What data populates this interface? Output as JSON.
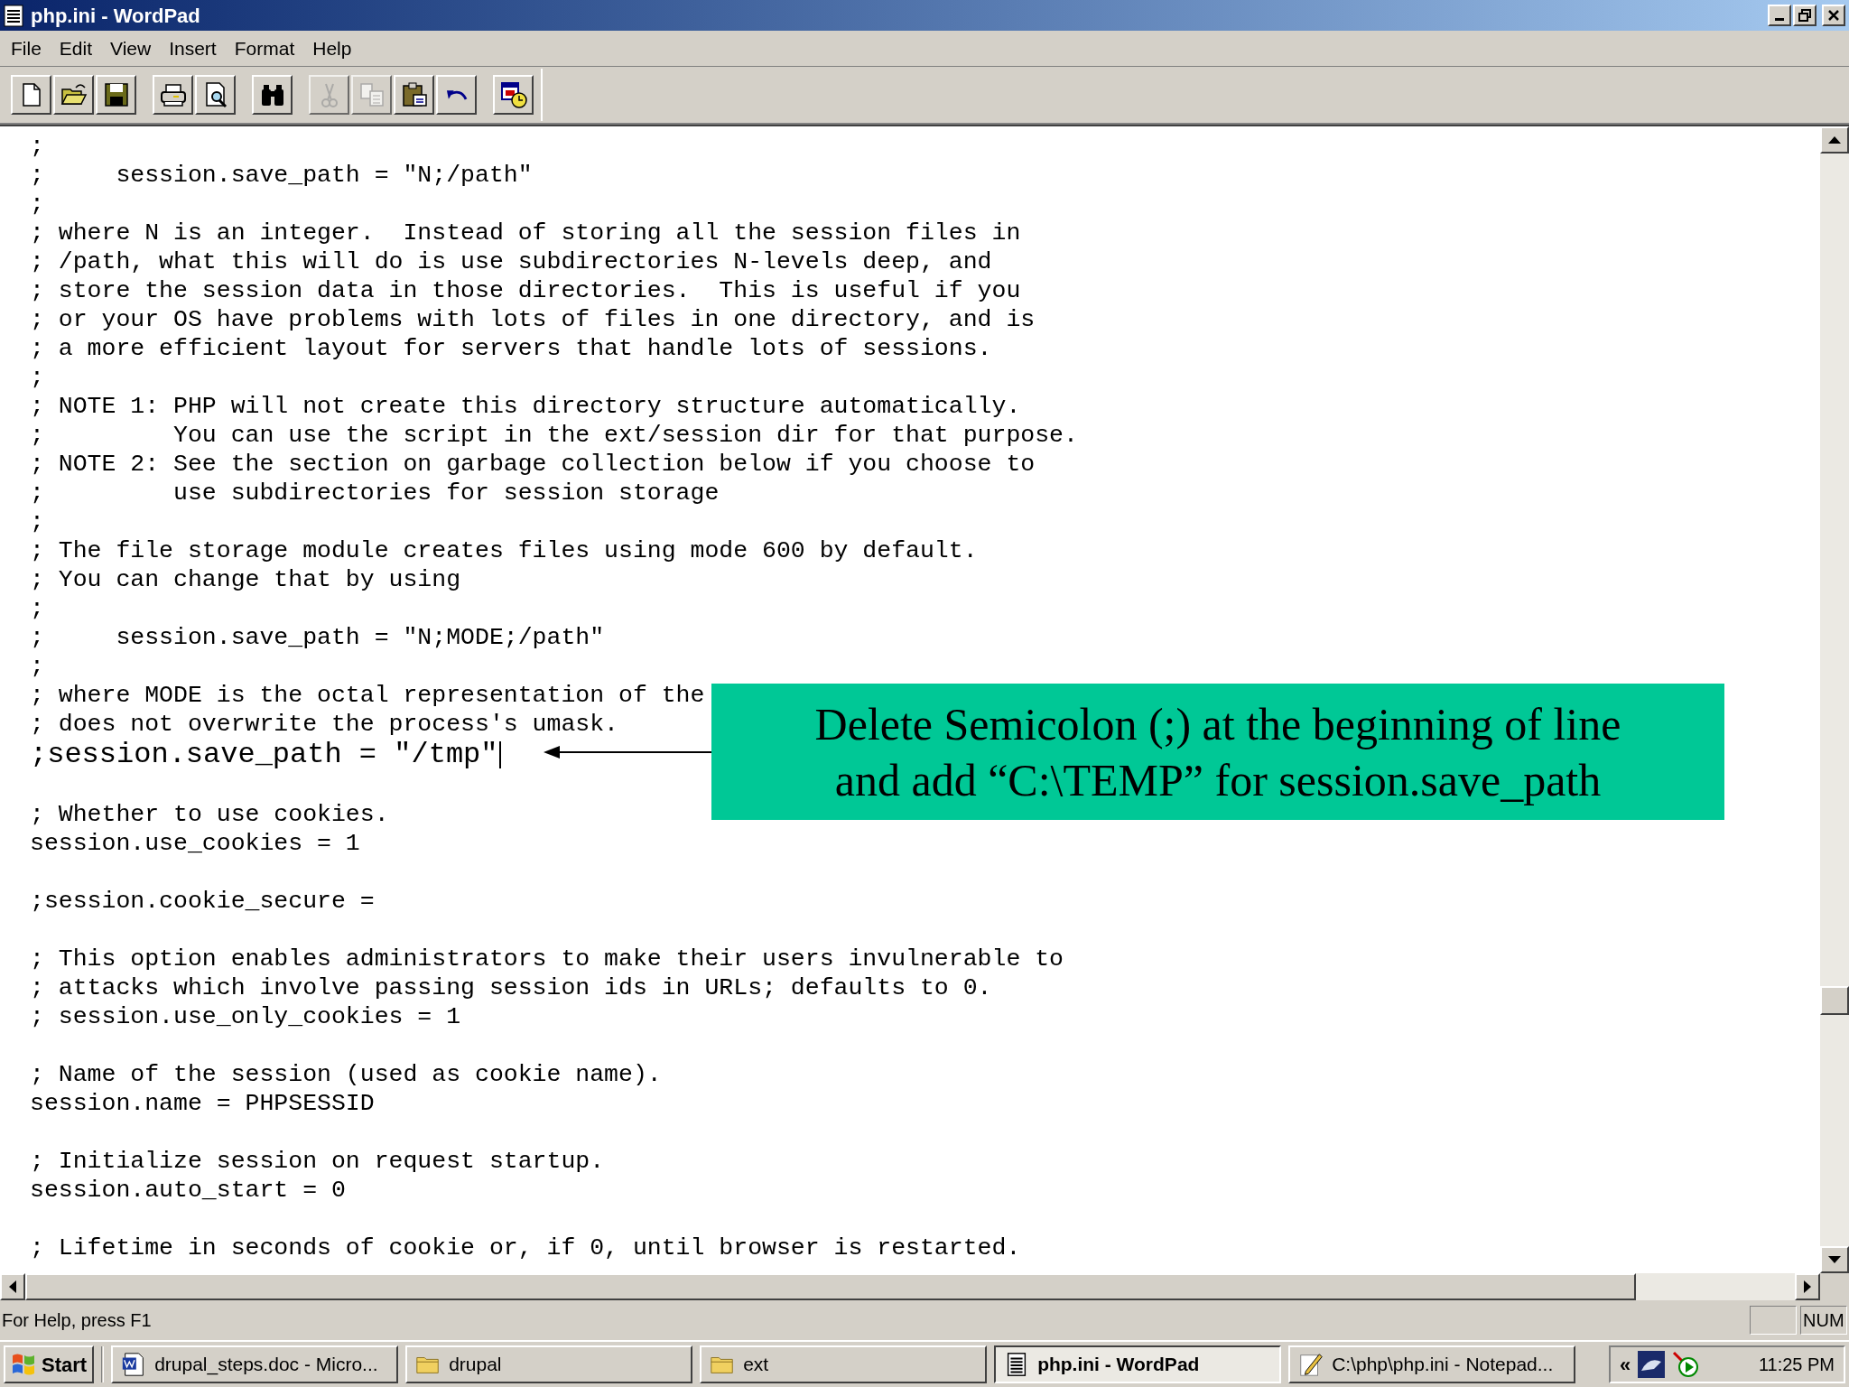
{
  "window": {
    "title": "php.ini - WordPad"
  },
  "menu": [
    "File",
    "Edit",
    "View",
    "Insert",
    "Format",
    "Help"
  ],
  "toolbar": [
    [
      {
        "kind": "new",
        "disabled": false
      },
      {
        "kind": "open",
        "disabled": false
      },
      {
        "kind": "save",
        "disabled": false
      }
    ],
    [
      {
        "kind": "print",
        "disabled": false
      },
      {
        "kind": "preview",
        "disabled": false
      }
    ],
    [
      {
        "kind": "find",
        "disabled": false
      }
    ],
    [
      {
        "kind": "cut",
        "disabled": true
      },
      {
        "kind": "copy",
        "disabled": true
      },
      {
        "kind": "paste",
        "disabled": false
      },
      {
        "kind": "undo",
        "disabled": false
      }
    ],
    [
      {
        "kind": "datetime",
        "disabled": false
      }
    ]
  ],
  "document": {
    "lines": [
      {
        "kind": "normal",
        "text": ";"
      },
      {
        "kind": "normal",
        "text": ";     session.save_path = \"N;/path\""
      },
      {
        "kind": "normal",
        "text": ";"
      },
      {
        "kind": "normal",
        "text": "; where N is an integer.  Instead of storing all the session files in"
      },
      {
        "kind": "normal",
        "text": "; /path, what this will do is use subdirectories N-levels deep, and"
      },
      {
        "kind": "normal",
        "text": "; store the session data in those directories.  This is useful if you"
      },
      {
        "kind": "normal",
        "text": "; or your OS have problems with lots of files in one directory, and is"
      },
      {
        "kind": "normal",
        "text": "; a more efficient layout for servers that handle lots of sessions."
      },
      {
        "kind": "normal",
        "text": ";"
      },
      {
        "kind": "normal",
        "text": "; NOTE 1: PHP will not create this directory structure automatically."
      },
      {
        "kind": "normal",
        "text": ";         You can use the script in the ext/session dir for that purpose."
      },
      {
        "kind": "normal",
        "text": "; NOTE 2: See the section on garbage collection below if you choose to"
      },
      {
        "kind": "normal",
        "text": ";         use subdirectories for session storage"
      },
      {
        "kind": "normal",
        "text": ";"
      },
      {
        "kind": "normal",
        "text": "; The file storage module creates files using mode 600 by default."
      },
      {
        "kind": "normal",
        "text": "; You can change that by using"
      },
      {
        "kind": "normal",
        "text": ";"
      },
      {
        "kind": "normal",
        "text": ";     session.save_path = \"N;MODE;/path\""
      },
      {
        "kind": "normal",
        "text": ";"
      },
      {
        "kind": "normal",
        "text": "; where MODE is the octal representation of the"
      },
      {
        "kind": "normal",
        "text": "; does not overwrite the process's umask."
      },
      {
        "kind": "large",
        "text": ";session.save_path = \"/tmp\""
      },
      {
        "kind": "blank"
      },
      {
        "kind": "normal",
        "text": "; Whether to use cookies."
      },
      {
        "kind": "normal",
        "text": "session.use_cookies = 1"
      },
      {
        "kind": "blank"
      },
      {
        "kind": "normal",
        "text": ";session.cookie_secure ="
      },
      {
        "kind": "blank"
      },
      {
        "kind": "normal",
        "text": "; This option enables administrators to make their users invulnerable to"
      },
      {
        "kind": "normal",
        "text": "; attacks which involve passing session ids in URLs; defaults to 0."
      },
      {
        "kind": "normal",
        "text": "; session.use_only_cookies = 1"
      },
      {
        "kind": "blank"
      },
      {
        "kind": "normal",
        "text": "; Name of the session (used as cookie name)."
      },
      {
        "kind": "normal",
        "text": "session.name = PHPSESSID"
      },
      {
        "kind": "blank"
      },
      {
        "kind": "normal",
        "text": "; Initialize session on request startup."
      },
      {
        "kind": "normal",
        "text": "session.auto_start = 0"
      },
      {
        "kind": "blank"
      },
      {
        "kind": "normal",
        "text": "; Lifetime in seconds of cookie or, if 0, until browser is restarted."
      }
    ]
  },
  "callout": {
    "text": "Delete Semicolon (;) at the beginning of line\nand add “C:\\TEMP” for session.save_path"
  },
  "status_bar": {
    "text": "For Help, press F1",
    "panels": [
      "NUM"
    ]
  },
  "taskbar": {
    "start": "Start",
    "items": [
      {
        "kind": "word",
        "label": "drupal_steps.doc - Micro...",
        "selected": false
      },
      {
        "kind": "folder",
        "label": "drupal",
        "selected": false
      },
      {
        "kind": "folder",
        "label": "ext",
        "selected": false
      },
      {
        "kind": "wordpad",
        "label": "php.ini - WordPad",
        "selected": true
      },
      {
        "kind": "notepad",
        "label": "C:\\php\\php.ini - Notepad...",
        "selected": false
      }
    ],
    "tray_toggle": "«",
    "clock": "11:25 PM"
  }
}
